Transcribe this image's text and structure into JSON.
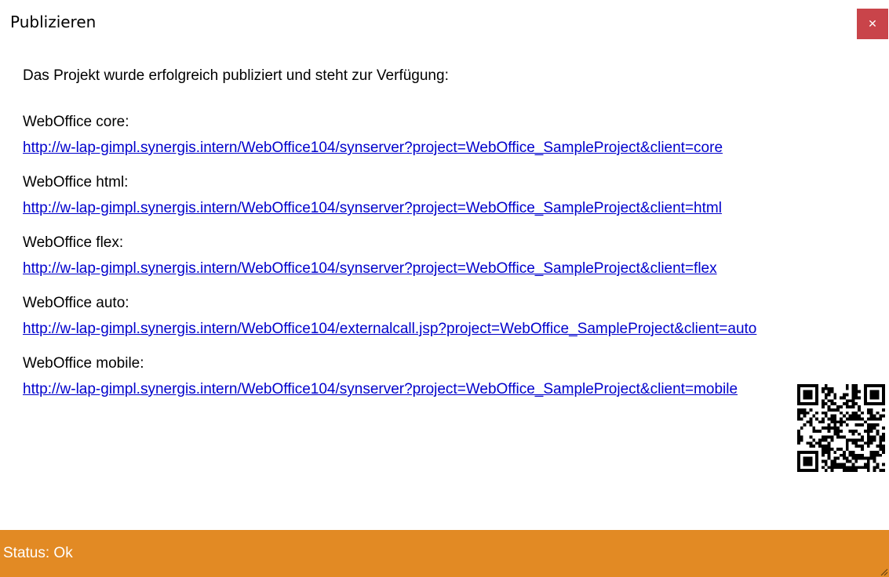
{
  "dialog": {
    "title": "Publizieren",
    "close_label": "✕"
  },
  "content": {
    "intro": "Das Projekt wurde erfolgreich publiziert und steht zur Verfügung:",
    "clients": [
      {
        "label": "WebOffice core:",
        "url": "http://w-lap-gimpl.synergis.intern/WebOffice104/synserver?project=WebOffice_SampleProject&client=core"
      },
      {
        "label": "WebOffice html:",
        "url": "http://w-lap-gimpl.synergis.intern/WebOffice104/synserver?project=WebOffice_SampleProject&client=html"
      },
      {
        "label": "WebOffice flex:",
        "url": "http://w-lap-gimpl.synergis.intern/WebOffice104/synserver?project=WebOffice_SampleProject&client=flex"
      },
      {
        "label": "WebOffice auto:",
        "url": "http://w-lap-gimpl.synergis.intern/WebOffice104/externalcall.jsp?project=WebOffice_SampleProject&client=auto"
      },
      {
        "label": "WebOffice mobile:",
        "url": "http://w-lap-gimpl.synergis.intern/WebOffice104/synserver?project=WebOffice_SampleProject&client=mobile"
      }
    ]
  },
  "qr": {
    "icon": "qr-code-icon"
  },
  "status": {
    "text": "Status: Ok",
    "color": "#e28a24"
  },
  "colors": {
    "close": "#c9444a",
    "link": "#0000cc"
  }
}
